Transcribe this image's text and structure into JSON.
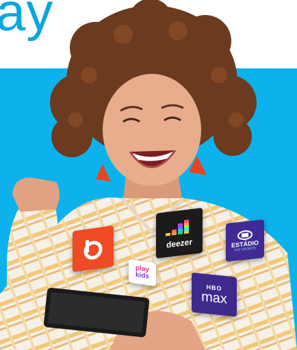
{
  "hero": {
    "headline": "ay"
  },
  "apps": {
    "deezer": {
      "label": "deezer"
    },
    "playkids": {
      "line1": "play",
      "line2": "kids"
    },
    "estadio": {
      "label": "ESTÁDIO",
      "sub": "TNT SPORTS"
    },
    "hbomax": {
      "top": "HBO",
      "label": "max"
    }
  },
  "colors": {
    "brand_blue": "#0db2ec",
    "headline_blue": "#0aa6e0",
    "bis_orange": "#ee4a23",
    "deezer_black": "#1b1b1b",
    "estadio_purple": "#3f2b93",
    "hbo_purple": "#3e2a8c"
  }
}
